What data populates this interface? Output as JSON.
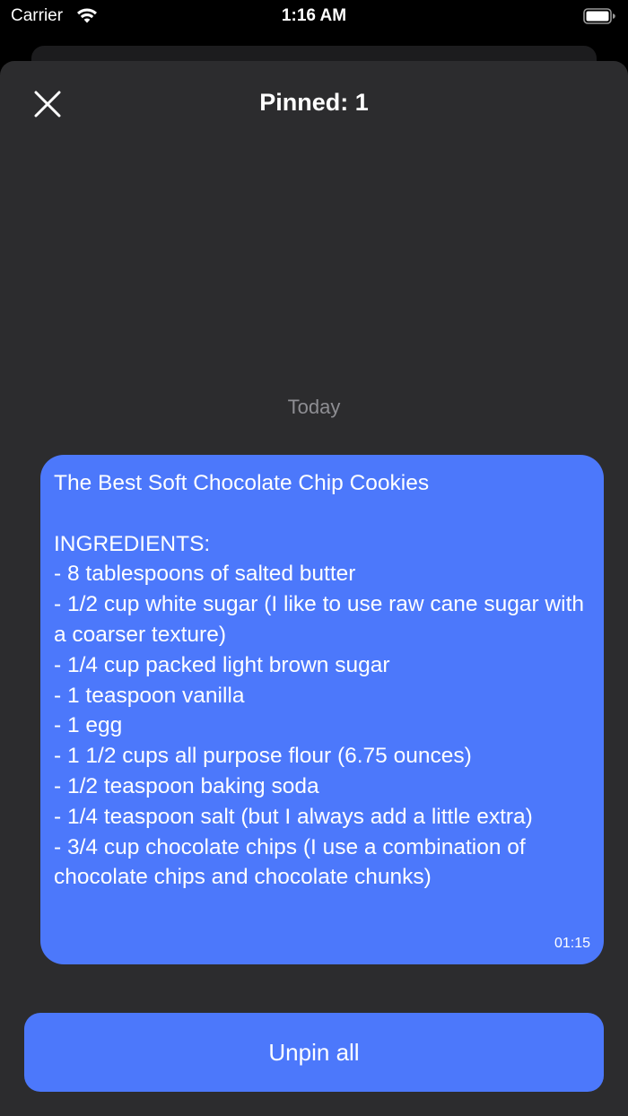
{
  "status_bar": {
    "carrier": "Carrier",
    "time": "1:16 AM",
    "wifi_icon": "wifi-icon",
    "battery_icon": "battery-icon"
  },
  "header": {
    "close_icon": "close-icon",
    "title": "Pinned: 1"
  },
  "messages": {
    "date_label": "Today",
    "items": [
      {
        "text": "The Best Soft Chocolate Chip Cookies\n\nINGREDIENTS:\n- 8 tablespoons of salted butter\n- 1/2 cup white sugar (I like to use raw cane sugar with a coarser texture)\n- 1/4 cup packed light brown sugar\n- 1 teaspoon vanilla\n- 1 egg\n- 1 1/2 cups all purpose flour (6.75 ounces)\n- 1/2 teaspoon baking soda\n- 1/4 teaspoon salt (but I always add a little extra)\n- 3/4 cup chocolate chips (I use a combination of chocolate chips and chocolate chunks)",
        "time": "01:15"
      }
    ]
  },
  "footer": {
    "unpin_label": "Unpin all"
  },
  "colors": {
    "accent": "#4c78fb",
    "sheet_background": "#2c2c2e",
    "secondary_text": "#8e8e93"
  }
}
